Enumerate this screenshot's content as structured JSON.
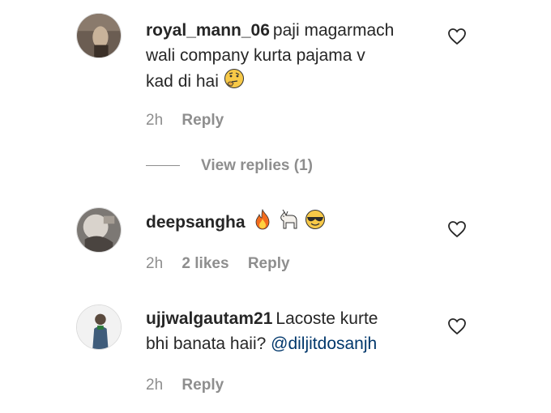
{
  "comments": [
    {
      "username": "royal_mann_06",
      "text_lines": [
        "paji magarmach",
        "wali company kurta pajama v",
        "kad di hai"
      ],
      "emoji": "thinking-face",
      "time": "2h",
      "reply_label": "Reply",
      "view_replies": "View replies (1)"
    },
    {
      "username": "deepsangha",
      "emojis": [
        "fire",
        "goat",
        "sunglasses-face"
      ],
      "time": "2h",
      "likes": "2 likes",
      "reply_label": "Reply"
    },
    {
      "username": "ujjwalgautam21",
      "text_line1": "Lacoste kurte",
      "text_line2": "bhi banata haii?",
      "mention": "@diljitdosanjh",
      "time": "2h",
      "reply_label": "Reply"
    }
  ],
  "colors": {
    "text": "#262626",
    "secondary": "#8e8e8e",
    "mention": "#00376b"
  }
}
